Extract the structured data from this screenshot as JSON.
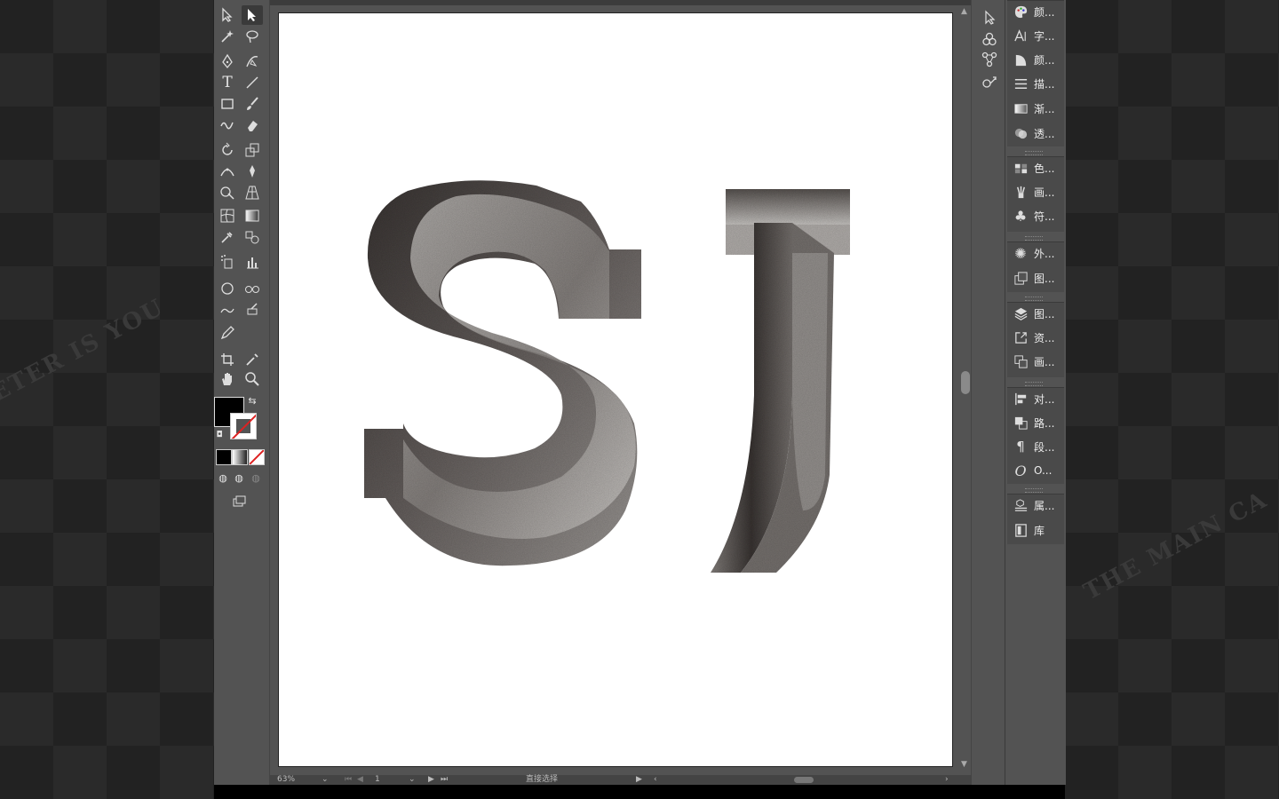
{
  "tools": {
    "selection": "selection-tool",
    "direct_selection": "direct-selection-tool"
  },
  "status": {
    "zoom": "63%",
    "artboard_number": "1",
    "current_tool": "直接选择"
  },
  "panels": [
    {
      "icon": "color-palette-icon",
      "label": "颜..."
    },
    {
      "icon": "character-icon",
      "label": "字..."
    },
    {
      "icon": "color-guide-icon",
      "label": "颜..."
    },
    {
      "icon": "stroke-icon",
      "label": "描..."
    },
    {
      "icon": "gradient-icon",
      "label": "渐..."
    },
    {
      "icon": "transparency-icon",
      "label": "透..."
    },
    {
      "icon": "swatches-icon",
      "label": "色..."
    },
    {
      "icon": "brushes-icon",
      "label": "画..."
    },
    {
      "icon": "symbols-icon",
      "label": "符..."
    },
    {
      "icon": "appearance-icon",
      "label": "外..."
    },
    {
      "icon": "graphic-styles-icon",
      "label": "图..."
    },
    {
      "icon": "layers-icon",
      "label": "图..."
    },
    {
      "icon": "asset-export-icon",
      "label": "资..."
    },
    {
      "icon": "artboards-icon",
      "label": "画..."
    },
    {
      "icon": "align-icon",
      "label": "对..."
    },
    {
      "icon": "pathfinder-icon",
      "label": "路..."
    },
    {
      "icon": "paragraph-icon",
      "label": "段..."
    },
    {
      "icon": "opentype-icon",
      "label": "O..."
    },
    {
      "icon": "properties-icon",
      "label": "属..."
    },
    {
      "icon": "libraries-icon",
      "label": "库"
    }
  ],
  "artwork": {
    "letters": "SJ"
  },
  "watermark": {
    "left_text": "ETER IS YOU",
    "right_text": "THE MAIN CA"
  },
  "colors": {
    "fill": "#000000",
    "stroke": "none",
    "ui_background": "#535353"
  }
}
